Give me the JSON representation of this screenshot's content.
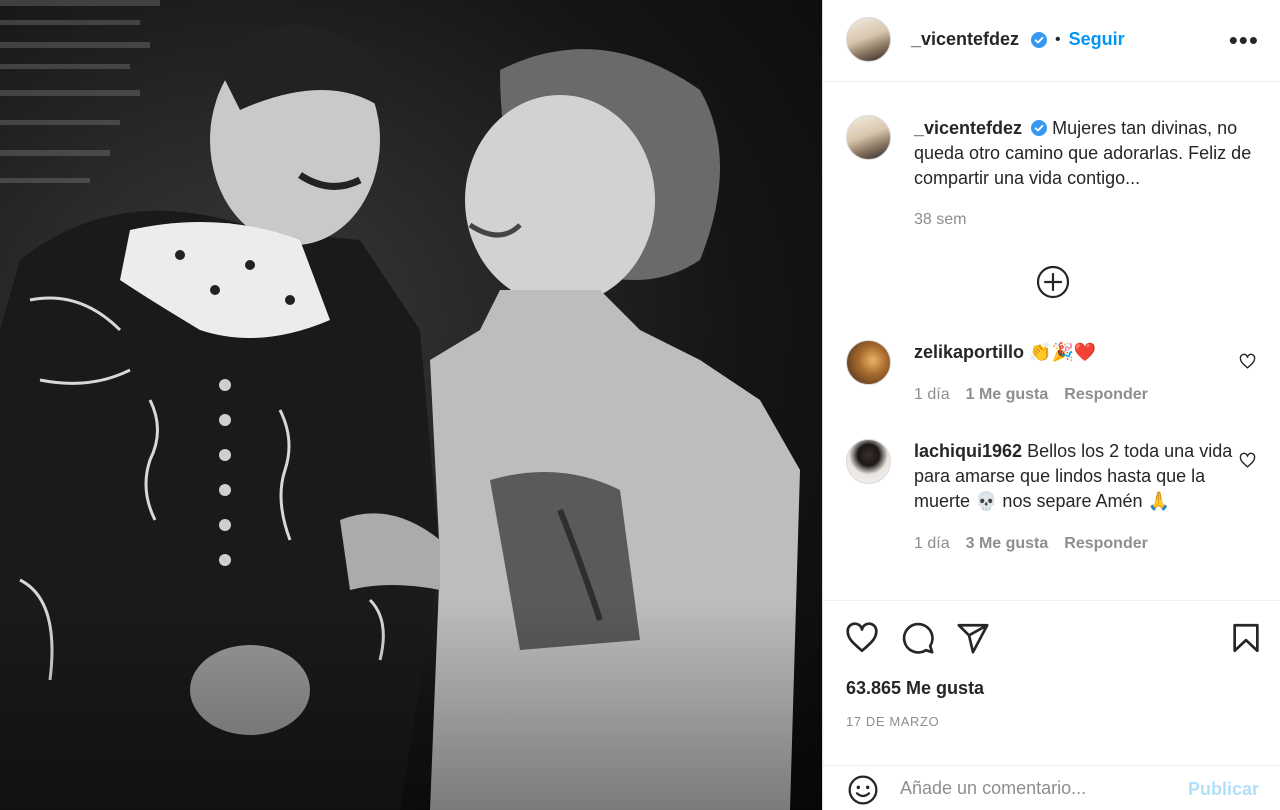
{
  "post": {
    "author": "_vicentefdez",
    "follow_label": "Seguir",
    "separator": "•",
    "more_label": "•••",
    "caption": "Mujeres tan divinas, no queda otro camino que adorarlas. Feliz de compartir una vida contigo...",
    "caption_time": "38 sem",
    "likes_text": "63.865 Me gusta",
    "date_text": "17 DE MARZO"
  },
  "comments": [
    {
      "username": "zelikaportillo",
      "text": "👏🎉❤️",
      "time": "1 día",
      "likes": "1 Me gusta",
      "reply": "Responder"
    },
    {
      "username": "lachiqui1962",
      "text": "Bellos los 2 toda una vida para amarse que lindos hasta que la muerte 💀 nos separe Amén 🙏",
      "time": "1 día",
      "likes": "3 Me gusta",
      "reply": "Responder"
    }
  ],
  "composer": {
    "placeholder": "Añade un comentario...",
    "post_label": "Publicar"
  },
  "colors": {
    "accent": "#0095f6",
    "verified": "#3897f0",
    "muted": "#8e8e8e",
    "text": "#262626",
    "post_disabled": "#b2dffc"
  },
  "icons": {
    "header": [
      "verified-badge-icon",
      "more-options-icon"
    ],
    "caption": [
      "load-more-comments-icon"
    ],
    "actions": [
      "heart-icon",
      "comment-icon",
      "share-icon",
      "bookmark-icon"
    ],
    "composer": [
      "emoji-icon"
    ]
  }
}
